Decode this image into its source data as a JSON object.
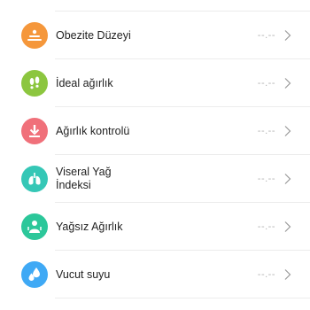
{
  "metrics": [
    {
      "label": "Obezite Düzeyi",
      "value": "--.--",
      "icon": "obesity-level-icon",
      "color": "#f5973b"
    },
    {
      "label": "İdeal ağırlık",
      "value": "--.--",
      "icon": "footprints-icon",
      "color": "#8cc63f"
    },
    {
      "label": "Ağırlık kontrolü",
      "value": "--.--",
      "icon": "weight-control-icon",
      "color": "#f0707a"
    },
    {
      "label": "Viseral Yağ\nİndeksi",
      "value": "--.--",
      "icon": "lungs-icon",
      "color": "#35c7b6"
    },
    {
      "label": "Yağsız Ağırlık",
      "value": "--.--",
      "icon": "lean-body-icon",
      "color": "#2cc79a"
    },
    {
      "label": "Vucut suyu",
      "value": "--.--",
      "icon": "water-drops-icon",
      "color": "#3fa9f5"
    }
  ]
}
